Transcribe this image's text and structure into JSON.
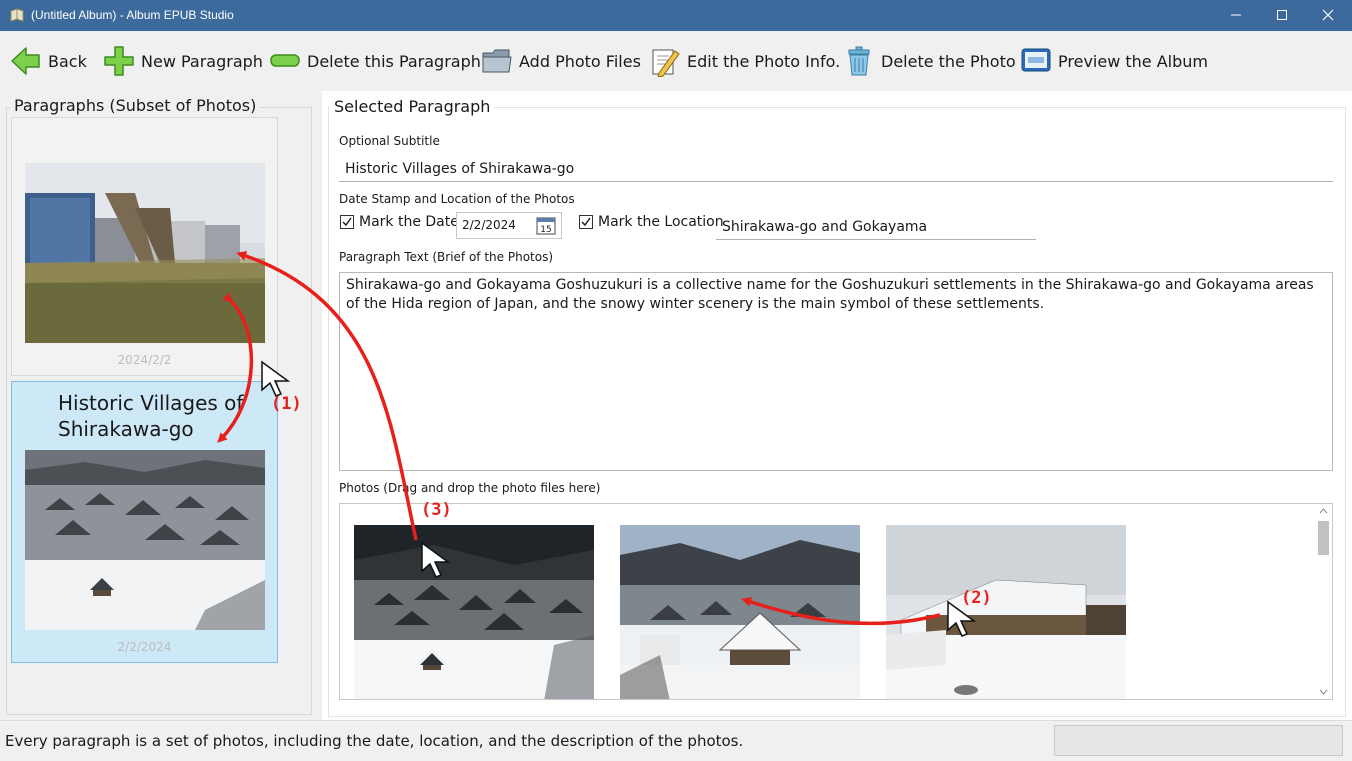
{
  "window": {
    "title": "(Untitled Album) - Album EPUB Studio",
    "controls": [
      "minimize",
      "maximize",
      "close"
    ]
  },
  "toolbar": {
    "items": [
      {
        "label": "Back",
        "icon": "back-arrow-icon"
      },
      {
        "label": "New Paragraph",
        "icon": "plus-icon"
      },
      {
        "label": "Delete this Paragraph",
        "icon": "minus-icon"
      },
      {
        "label": "Add Photo Files",
        "icon": "folder-icon"
      },
      {
        "label": "Edit the Photo Info.",
        "icon": "edit-pencil-icon"
      },
      {
        "label": "Delete the Photo",
        "icon": "trash-icon"
      },
      {
        "label": "Preview the Album",
        "icon": "monitor-icon"
      }
    ]
  },
  "paragraphs_panel": {
    "title": "Paragraphs (Subset of Photos)",
    "cards": [
      {
        "subtitle": "",
        "date": "2024/2/2",
        "selected": false
      },
      {
        "subtitle": "Historic Villages of Shirakawa-go",
        "date": "2/2/2024",
        "selected": true
      }
    ]
  },
  "selected_paragraph": {
    "title": "Selected Paragraph",
    "subtitle_label": "Optional Subtitle",
    "subtitle_value": "Historic Villages of Shirakawa-go",
    "date_location_label": "Date Stamp and Location of the Photos",
    "mark_date_label": "Mark the Date:",
    "mark_date_checked": true,
    "date_value": "2/2/2024",
    "calendar_day": "15",
    "mark_location_label": "Mark the Location",
    "mark_location_checked": true,
    "location_value": "Shirakawa-go and Gokayama",
    "text_label": "Paragraph Text (Brief of the Photos)",
    "text_value": "Shirakawa-go and Gokayama Goshuzukuri is a collective name for the Goshuzukuri settlements in the Shirakawa-go and Gokayama areas of the Hida region of Japan, and the snowy winter scenery is the main symbol of these settlements.",
    "photos_label": "Photos (Drag and drop the photo files here)"
  },
  "status": {
    "text": "Every paragraph is a set of photos, including the date, location, and the description of the photos."
  },
  "annotations": {
    "labels": [
      "(1)",
      "(2)",
      "(3)"
    ],
    "color": "#e8201c"
  },
  "colors": {
    "titlebar": "#3c6a9c",
    "selected_card": "#cde8f7",
    "selected_border": "#7dbde3"
  }
}
